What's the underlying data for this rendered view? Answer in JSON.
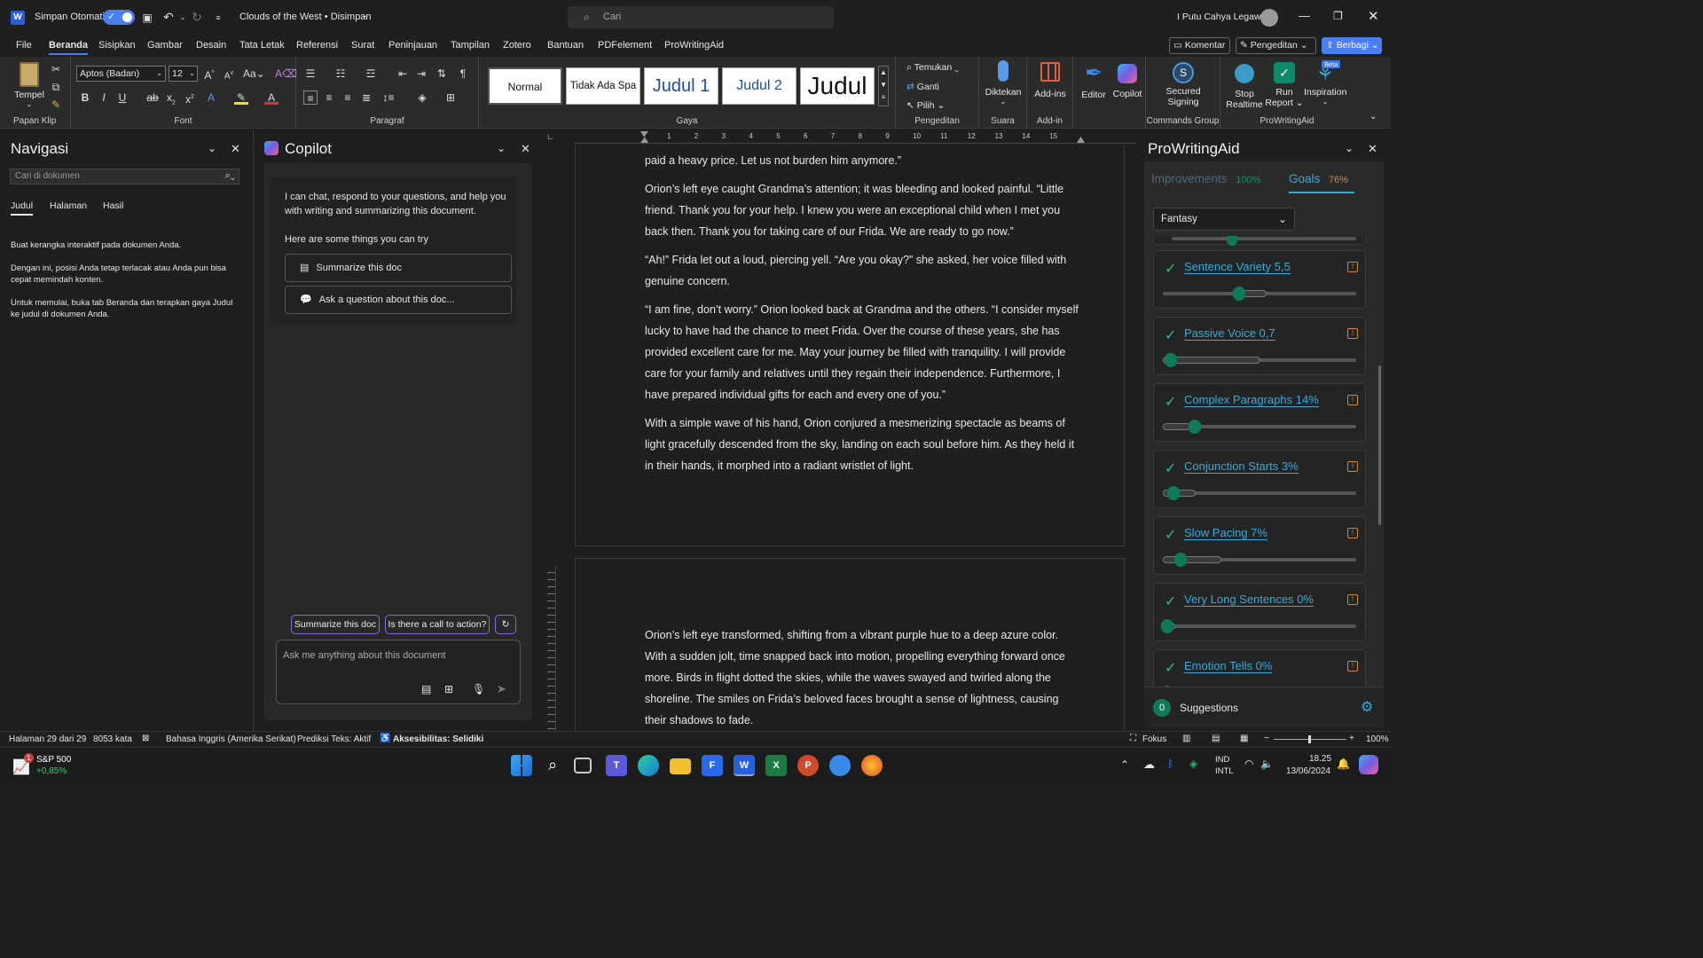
{
  "titlebar": {
    "autosave_label": "Simpan Otomatis",
    "doc_title": "Clouds of the West • Disimpan",
    "search_placeholder": "Cari",
    "user_name": "I Putu Cahya Legawa"
  },
  "menu": {
    "items": [
      "File",
      "Beranda",
      "Sisipkan",
      "Gambar",
      "Desain",
      "Tata Letak",
      "Referensi",
      "Surat",
      "Peninjauan",
      "Tampilan",
      "Zotero",
      "Bantuan",
      "PDFelement",
      "ProWritingAid"
    ],
    "active": "Beranda",
    "comment_button": "Komentar",
    "editing_button": "Pengeditan",
    "share_button": "Berbagi"
  },
  "ribbon": {
    "paste_label": "Tempel",
    "clipboard_group": "Papan Klip",
    "font_name": "Aptos (Badan)",
    "font_size": "12",
    "font_group": "Font",
    "paragraph_group": "Paragraf",
    "styles": [
      "Normal",
      "Tidak Ada Spa",
      "Judul 1",
      "Judul 2",
      "Judul"
    ],
    "styles_group": "Gaya",
    "find_label": "Temukan",
    "replace_label": "Ganti",
    "select_label": "Pilih",
    "editing_group": "Pengeditan",
    "dictate_label": "Diktekan",
    "voice_group": "Suara",
    "addins_label": "Add-ins",
    "addins_group": "Add-in",
    "editor_label": "Editor",
    "copilot_label": "Copilot",
    "secured_label": "Secured",
    "signing_label": "Signing",
    "commands_group": "Commands Group",
    "stop_label": "Stop",
    "realtime_label": "Realtime",
    "run_label": "Run",
    "report_label": "Report",
    "inspiration_label": "Inspiration",
    "beta_badge": "Beta",
    "pwa_group": "ProWritingAid"
  },
  "nav": {
    "title": "Navigasi",
    "search_placeholder": "Cari di dokumen",
    "tabs": [
      "Judul",
      "Halaman",
      "Hasil"
    ],
    "p1": "Buat kerangka interaktif pada dokumen Anda.",
    "p2": "Dengan ini, posisi Anda tetap terlacak atau Anda pun bisa cepat memindah konten.",
    "p3": "Untuk memulai, buka tab Beranda dan terapkan gaya Judul ke judul di dokumen Anda."
  },
  "copilot": {
    "title": "Copilot",
    "intro": "I can chat, respond to your questions, and help you with writing and summarizing this document.",
    "things": "Here are some things you can try",
    "opt1": "Summarize this doc",
    "opt2": "Ask a question about this doc...",
    "chip1": "Summarize this doc",
    "chip2": "Is there a call to action?",
    "input_placeholder": "Ask me anything about this document"
  },
  "doc": {
    "ruler_marks": [
      "1",
      "2",
      "3",
      "4",
      "5",
      "6",
      "7",
      "8",
      "9",
      "10",
      "11",
      "12",
      "13",
      "14",
      "15"
    ],
    "page1": [
      "paid a heavy price. Let us not burden him anymore.”",
      "Orion’s left eye caught Grandma’s attention; it was bleeding and looked painful. “Little friend. Thank you for your help. I knew you were an exceptional child when I met you back then. Thank you for taking care of our Frida. We are ready to go now.”",
      "“Ah!” Frida let out a loud, piercing yell. “Are you okay?” she asked, her voice filled with genuine concern.",
      "“I am fine, don’t worry.” Orion looked back at Grandma and the others. “I consider myself lucky to have had the chance to meet Frida. Over the course of these years, she has provided excellent care for me. May your journey be filled with tranquility. I will provide care for your family and relatives until they regain their independence. Furthermore, I have prepared individual gifts for each and every one of you.”",
      "With a simple wave of his hand, Orion conjured a mesmerizing spectacle as beams of light gracefully descended from the sky, landing on each soul before him. As they held it in their hands, it morphed into a radiant wristlet of light."
    ],
    "page2": "Orion’s left eye transformed, shifting from a vibrant purple hue to a deep azure color. With a sudden jolt, time snapped back into motion, propelling everything forward once more. Birds in flight dotted the skies, while the waves swayed and twirled along the shoreline. The smiles on Frida’s beloved faces brought a sense of lightness, causing their shadows to fade."
  },
  "pwa": {
    "title": "ProWritingAid",
    "tab_improvements": "Improvements",
    "improvements_pct": "100%",
    "tab_goals": "Goals",
    "goals_pct": "76%",
    "genre": "Fantasy",
    "goals": [
      {
        "label": "Sentence Variety 5,5",
        "value": 0.37,
        "lo": 0.36,
        "hi": 0.53
      },
      {
        "label": "Passive Voice 0,7",
        "value": 0.02,
        "lo": 0.0,
        "hi": 0.5
      },
      {
        "label": "Complex Paragraphs 14%",
        "value": 0.14,
        "lo": 0.0,
        "hi": 0.14
      },
      {
        "label": "Conjunction Starts 3%",
        "value": 0.03,
        "lo": 0.0,
        "hi": 0.17
      },
      {
        "label": "Slow Pacing 7%",
        "value": 0.07,
        "lo": 0.0,
        "hi": 0.3
      },
      {
        "label": "Very Long Sentences 0%",
        "value": 0.0,
        "lo": 0.0,
        "hi": 0.06
      },
      {
        "label": "Emotion Tells 0%",
        "value": 0.0,
        "lo": 0.0,
        "hi": 0.1
      }
    ],
    "suggestions_count": "0",
    "suggestions_label": "Suggestions"
  },
  "status": {
    "page": "Halaman 29 dari 29",
    "words": "8053 kata",
    "language": "Bahasa Inggris (Amerika Serikat)",
    "prediction": "Prediksi Teks: Aktif",
    "accessibility": "Aksesibilitas: Selidiki",
    "focus": "Fokus",
    "zoom": "100%"
  },
  "taskbar": {
    "stock_name": "S&P 500",
    "stock_change": "+0,85%",
    "stock_badge": "1",
    "lang1": "IND",
    "lang2": "INTL",
    "time": "18.25",
    "date": "13/06/2024"
  },
  "colors": {
    "accent": "#4a7ef5",
    "pwa_green": "#0e7a5a",
    "link_blue": "#3aa9d8"
  }
}
